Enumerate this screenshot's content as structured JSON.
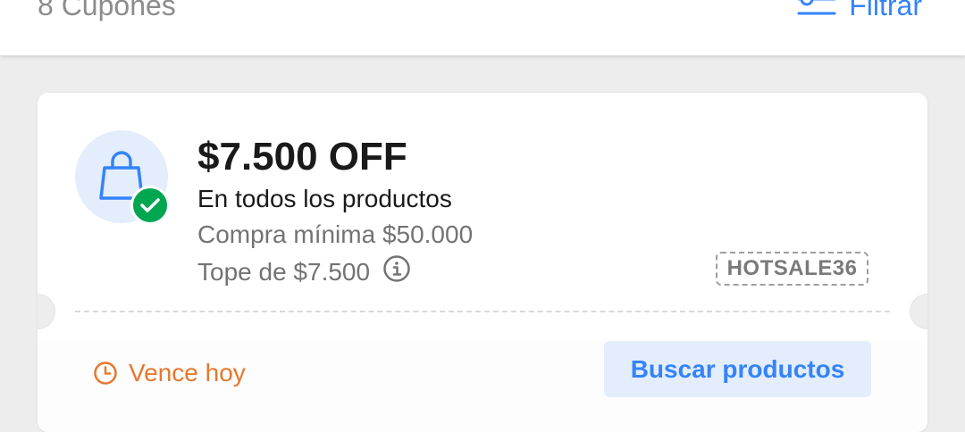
{
  "header": {
    "coupon_count": "8 Cupones",
    "filter_label": "Filtrar"
  },
  "coupon": {
    "amount": "$7.500 OFF",
    "scope": "En todos los productos",
    "min_purchase": "Compra mínima $50.000",
    "cap": "Tope de $7.500",
    "code": "HOTSALE36",
    "expiry": "Vence hoy",
    "action_label": "Buscar productos"
  },
  "colors": {
    "accent": "#3483fa",
    "accent_light": "#e3edfb",
    "success": "#00a650",
    "warning": "#e8772e",
    "background": "#ededed"
  },
  "icons": {
    "filter": "sliders-icon",
    "bag": "shopping-bag-icon",
    "check": "check-icon",
    "info": "info-icon",
    "clock": "clock-icon"
  }
}
